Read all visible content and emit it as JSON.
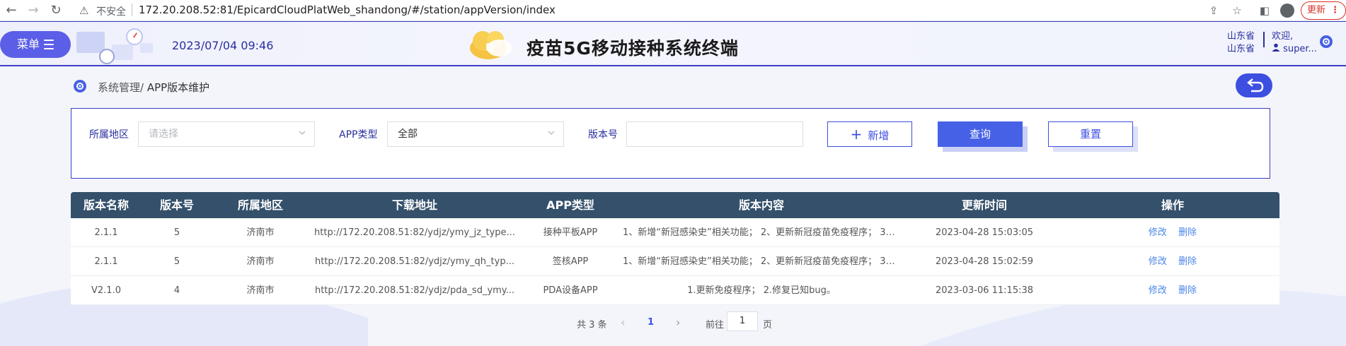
{
  "browser": {
    "insecure_label": "不安全",
    "url": "172.20.208.52:81/EpicardCloudPlatWeb_shandong/#/station/appVersion/index",
    "update_label": "更新"
  },
  "header": {
    "menu_label": "菜单",
    "datetime": "2023/07/04 09:46",
    "title": "疫苗5G移动接种系统终端",
    "region_line1": "山东省",
    "region_line2": "山东省",
    "welcome": "欢迎,",
    "username": "super..."
  },
  "breadcrumb": {
    "parent": "系统管理/",
    "current": " APP版本维护"
  },
  "filters": {
    "region_label": "所属地区",
    "region_placeholder": "请选择",
    "app_type_label": "APP类型",
    "app_type_value": "全部",
    "version_label": "版本号",
    "version_value": "",
    "add_label": "新增",
    "query_label": "查询",
    "reset_label": "重置"
  },
  "table": {
    "columns": [
      "版本名称",
      "版本号",
      "所属地区",
      "下载地址",
      "APP类型",
      "版本内容",
      "更新时间",
      "操作"
    ],
    "rows": [
      {
        "name": "2.1.1",
        "code": "5",
        "region": "济南市",
        "url": "http://172.20.208.51:82/ydjz/ymy_jz_type...",
        "type": "接种平板APP",
        "content": "1、新增“新冠感染史”相关功能； 2、更新新冠疫苗免疫程序； 3、...",
        "time": "2023-04-28 15:03:05",
        "edit": "修改",
        "delete": "删除"
      },
      {
        "name": "2.1.1",
        "code": "5",
        "region": "济南市",
        "url": "http://172.20.208.51:82/ydjz/ymy_qh_typ...",
        "type": "签核APP",
        "content": "1、新增“新冠感染史”相关功能； 2、更新新冠疫苗免疫程序； 3、...",
        "time": "2023-04-28 15:02:59",
        "edit": "修改",
        "delete": "删除"
      },
      {
        "name": "V2.1.0",
        "code": "4",
        "region": "济南市",
        "url": "http://172.20.208.51:82/ydjz/pda_sd_ymy...",
        "type": "PDA设备APP",
        "content": "1.更新免疫程序； 2.修复已知bug。",
        "time": "2023-03-06 11:15:38",
        "edit": "修改",
        "delete": "删除"
      }
    ]
  },
  "pagination": {
    "total": "共 3 条",
    "prev": "‹",
    "current_page": "1",
    "next": "›",
    "goto_label": "前往",
    "goto_value": "1",
    "page_suffix": "页"
  },
  "colors": {
    "primary": "#4661e6",
    "header_border": "#3b3fc4",
    "table_header": "#34506b",
    "link": "#4a86e8"
  }
}
